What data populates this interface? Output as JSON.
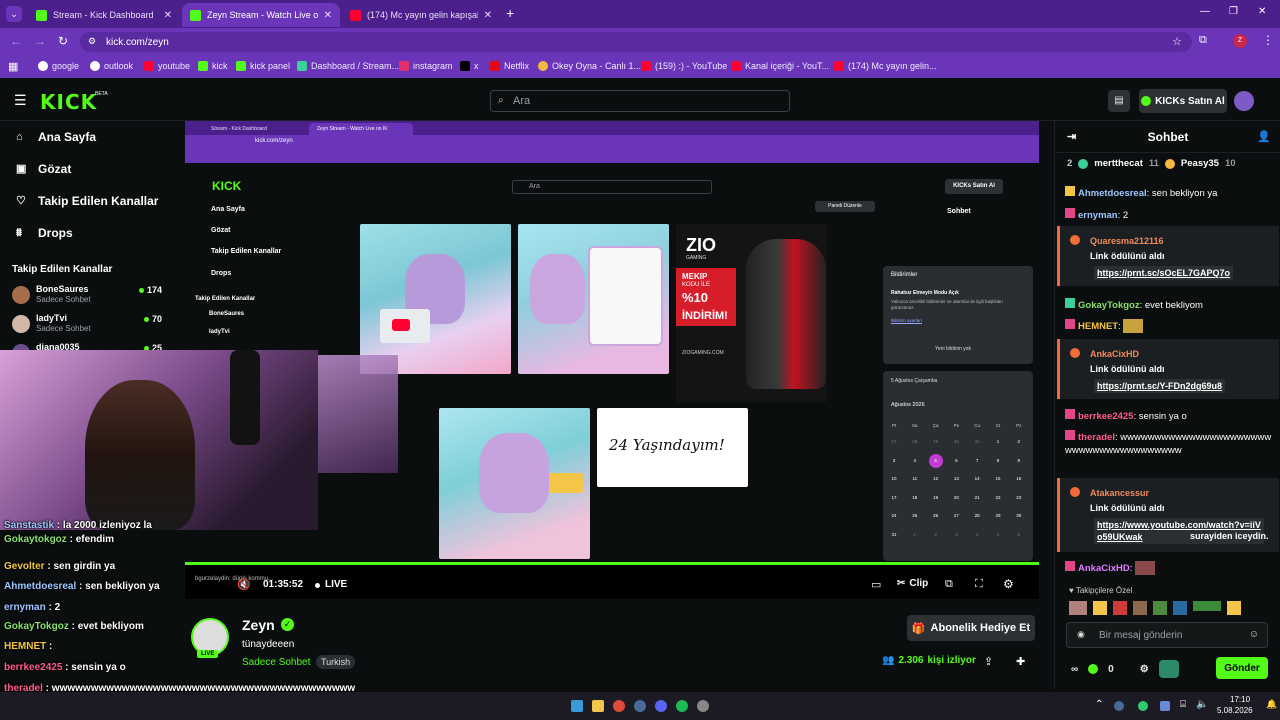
{
  "browser": {
    "tabs": [
      {
        "label": "Stream - Kick Dashboard",
        "color": "#53fc18"
      },
      {
        "label": "Zeyn Stream - Watch Live on Ki",
        "color": "#53fc18"
      },
      {
        "label": "(174) Mc yayın gelin kapışalım",
        "color": "#ff0033"
      }
    ],
    "url": "kick.com/zeyn",
    "bookmarks": [
      "google",
      "outlook",
      "youtube",
      "kick",
      "kick panel",
      "Dashboard / Stream...",
      "instagram",
      "x",
      "Netflix",
      "Okey Oyna - Canlı 1...",
      "(159) :) - YouTube",
      "Kanal içeriği - YouT...",
      "(174) Mc yayın gelin..."
    ],
    "new_tab": "+"
  },
  "kick": {
    "logo": "KICK",
    "beta": "BETA",
    "search_placeholder": "Ara",
    "kicks_button": "KICKs Satın Al",
    "accent": "#53fc18"
  },
  "sidebar": {
    "nav": [
      {
        "label": "Ana Sayfa",
        "icon": "home-icon"
      },
      {
        "label": "Gözat",
        "icon": "browse-icon"
      },
      {
        "label": "Takip Edilen Kanallar",
        "icon": "heart-icon"
      },
      {
        "label": "Drops",
        "icon": "drops-icon"
      }
    ],
    "followed_title": "Takip Edilen Kanallar",
    "channels": [
      {
        "name": "BoneSaures",
        "sub": "Sadece Sohbet",
        "viewers": "174"
      },
      {
        "name": "ladyTvi",
        "sub": "Sadece Sohbet",
        "viewers": "70"
      },
      {
        "name": "diana0035",
        "sub": "",
        "viewers": "25"
      }
    ]
  },
  "player": {
    "time": "01:35:52",
    "live": "LIVE",
    "clip": "Clip",
    "inner_logo": "KICK",
    "inner_search": "Ara",
    "inner_kicks": "KICKs Satın Al",
    "panel_edit": "Paneli Düzenle",
    "inner_chat_title": "Sohbet",
    "notif_title": "Bildirimler",
    "notif_mode": "Rahatsız Etmeyin Modu Açık",
    "notif_text": "Yalnızca öncelikli bildirimler ve alarmlar ile ilgili başlıkları görürsünüz.",
    "notif_settings": "Bildirim ayarları",
    "notif_empty": "Yeni bildirim yok",
    "date_label": "5 Ağustos Çarşamba",
    "month": "Ağustos 2026",
    "weekdays": [
      "Pt",
      "Sa",
      "Ça",
      "Pe",
      "Cu",
      "Ct",
      "Pz"
    ],
    "weeks": [
      [
        "27",
        "28",
        "29",
        "30",
        "31",
        "1",
        "2"
      ],
      [
        "3",
        "4",
        "5",
        "6",
        "7",
        "8",
        "9"
      ],
      [
        "10",
        "11",
        "12",
        "13",
        "14",
        "15",
        "16"
      ],
      [
        "17",
        "18",
        "19",
        "20",
        "21",
        "22",
        "23"
      ],
      [
        "24",
        "25",
        "26",
        "27",
        "28",
        "29",
        "30"
      ],
      [
        "31",
        "1",
        "2",
        "3",
        "4",
        "5",
        "6"
      ]
    ],
    "today": "5",
    "handwritten": "24 Yaşındayım!",
    "ad_brand": "ZIO",
    "ad_sub": "GAMING",
    "ad_code": "MEKIP",
    "ad_code_label": "KODU İLE",
    "ad_percent": "%10",
    "ad_discount": "İNDİRİM!",
    "ad_site": "ZIOGAMING.COM",
    "inner_bottom": "bgurzelaydin: dünki kommu..."
  },
  "overlay_chat": [
    {
      "user": "Sanstastik",
      "text": "la 2000 izleniyoz la",
      "color": "#9ec7ff"
    },
    {
      "user": "Gokaytokgoz",
      "text": "efendim",
      "color": "#8ae06f"
    },
    {
      "user": "Gevolter",
      "text": "sen girdin ya",
      "color": "#f5c542"
    },
    {
      "user": "Ahmetdoesreal",
      "text": "sen bekliyon ya",
      "color": "#9ec7ff"
    },
    {
      "user": "ernyman",
      "text": "2",
      "color": "#9ec7ff"
    },
    {
      "user": "GokayTokgoz",
      "text": "evet bekliyom",
      "color": "#8ae06f"
    },
    {
      "user": "HEMNET",
      "text": "",
      "color": "#f5c542"
    },
    {
      "user": "berrkee2425",
      "text": "sensin ya o",
      "color": "#ff5c8a"
    },
    {
      "user": "theradel",
      "text": "wwwwwwwwwwwwwwwwwwwwwwwwwwwwwwwwwwwwwww",
      "color": "#ff5c8a"
    },
    {
      "user": "AnkaCixHD",
      "text": "",
      "color": "#e07cff"
    }
  ],
  "streamer": {
    "name": "Zeyn",
    "title": "tünaydeeen",
    "category": "Sadece Sohbet",
    "language": "Turkish",
    "viewers": "2.306",
    "viewers_label": "kişi izliyor",
    "gift_button": "Abonelik Hediye Et",
    "live_badge": "LIVE"
  },
  "chat": {
    "title": "Sohbet",
    "top": [
      {
        "rank": "2",
        "user": "mertthecat",
        "count": "11"
      },
      {
        "rank": "",
        "user": "Peasy35",
        "count": "10"
      }
    ],
    "messages": [
      {
        "user": "Ahmetdoesreal",
        "text": "sen bekliyon ya",
        "color": "#9ec7ff"
      },
      {
        "user": "ernyman",
        "text": "2",
        "color": "#9ec7ff"
      }
    ],
    "redeems": [
      {
        "user": "Quaresma212116",
        "label": "Link ödülünü aldı",
        "url": "https://prnt.sc/sOcEL7GAPQ7o",
        "after": ""
      },
      {
        "user": "AnkaCixHD",
        "label": "Link ödülünü aldı",
        "url": "https://prnt.sc/Y-FDn2dg69u8",
        "after": ""
      },
      {
        "user": "Atakancessur",
        "label": "Link ödülünü aldı",
        "url": "https://www.youtube.com/watch?v=iiVo59UKwak",
        "after": "surayiden iceydin."
      }
    ],
    "mid_messages": [
      {
        "user": "GokayTokgoz",
        "text": "evet bekliyom",
        "color": "#8ae06f"
      },
      {
        "user": "HEMNET",
        "text": "",
        "color": "#f5c542"
      },
      {
        "user": "berrkee2425",
        "text": "sensin ya o",
        "color": "#ff5c8a"
      },
      {
        "user": "theradel",
        "text": "wwwwwwwwwwwwwwwwwwwwwwwwwwwwwwwwwwwwwww",
        "color": "#ff5c8a"
      },
      {
        "user": "AnkaCixHD",
        "text": "",
        "color": "#e07cff"
      }
    ],
    "follower_emotes": "Takipçilere Özel",
    "input_placeholder": "Bir mesaj gönderin",
    "points": "0",
    "send": "Gönder"
  },
  "taskbar": {
    "time": "17:10",
    "date": "5.08.2026"
  }
}
